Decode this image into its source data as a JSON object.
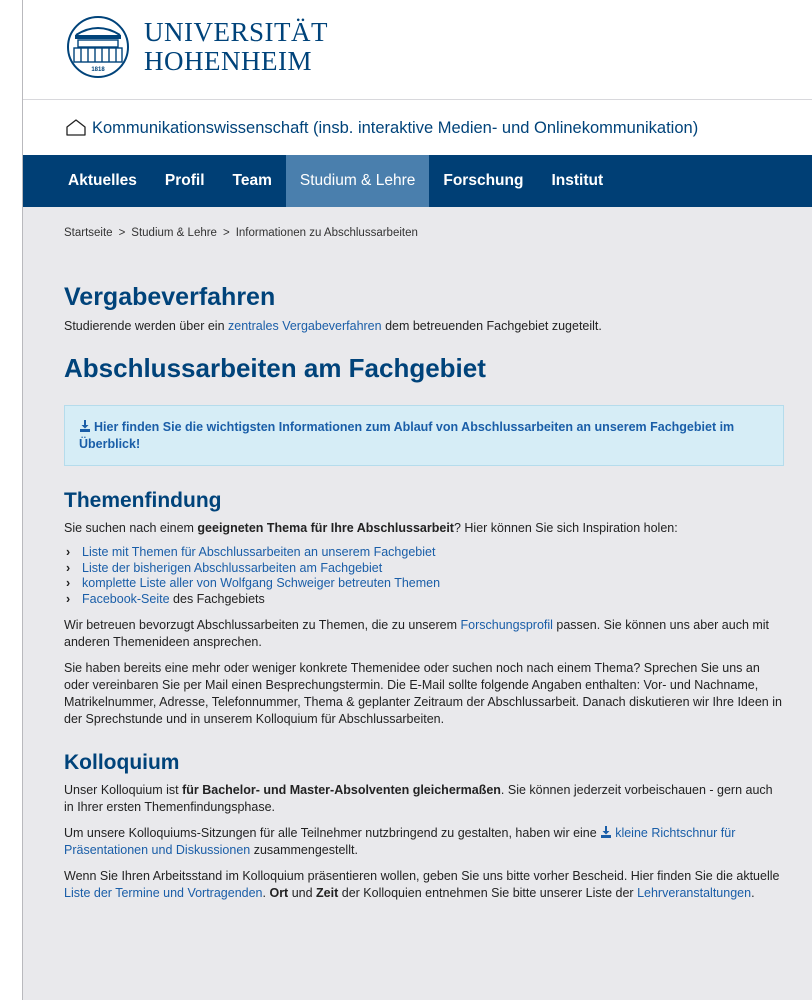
{
  "logo": {
    "line1": "UNIVERSITÄT",
    "line2": "HOHENHEIM",
    "year": "1818"
  },
  "subheader": {
    "label": "Kommunikationswissenschaft (insb. interaktive Medien- und Onlinekommunikation)"
  },
  "nav": {
    "items": [
      {
        "label": "Aktuelles"
      },
      {
        "label": "Profil"
      },
      {
        "label": "Team"
      },
      {
        "label": "Studium & Lehre"
      },
      {
        "label": "Forschung"
      },
      {
        "label": "Institut"
      }
    ],
    "active_index": 3
  },
  "breadcrumb": {
    "items": [
      "Startseite",
      "Studium & Lehre",
      "Informationen zu Abschlussarbeiten"
    ],
    "separator": ">"
  },
  "vergabe": {
    "title": "Vergabeverfahren",
    "text_before": "Studierende werden über ein ",
    "link": "zentrales Vergabeverfahren",
    "text_after": " dem betreuenden Fachgebiet zugeteilt."
  },
  "abschluss": {
    "title": "Abschlussarbeiten am Fachgebiet",
    "box_link": "Hier",
    "box_text": " finden Sie die wichtigsten Informationen zum Ablauf von Abschlussarbeiten an unserem Fachgebiet im Überblick!"
  },
  "themen": {
    "title": "Themenfindung",
    "intro_before": "Sie suchen nach einem ",
    "intro_bold": "geeigneten Thema für Ihre Abschlussarbeit",
    "intro_after": "? Hier können Sie sich Inspiration holen:",
    "links": [
      {
        "link": "Liste mit Themen für Abschlussarbeiten an unserem Fachgebiet",
        "after": ""
      },
      {
        "link": "Liste der bisherigen Abschlussarbeiten am Fachgebiet",
        "after": ""
      },
      {
        "link": "komplette Liste aller von Wolfgang Schweiger betreuten Themen",
        "after": ""
      },
      {
        "link": "Facebook-Seite",
        "after": " des Fachgebiets"
      }
    ],
    "p2_before": "Wir betreuen bevorzugt Abschlussarbeiten zu Themen, die zu unserem ",
    "p2_link": "Forschungsprofil",
    "p2_after": " passen. Sie können uns aber auch mit anderen Themenideen ansprechen.",
    "p3": "Sie haben bereits eine mehr oder weniger konkrete Themenidee oder suchen noch nach einem Thema? Sprechen Sie uns an oder vereinbaren Sie per Mail einen Besprechungstermin. Die E-Mail sollte folgende Angaben enthalten: Vor- und Nachname, Matrikelnummer, Adresse, Telefonnummer, Thema & geplanter Zeitraum der Abschlussarbeit. Danach diskutieren wir Ihre Ideen in der Sprechstunde und in unserem Kolloquium für Abschlussarbeiten."
  },
  "kolloquium": {
    "title": "Kolloquium",
    "p1_before": "Unser Kolloquium ist ",
    "p1_bold": "für Bachelor- und Master-Absolventen gleichermaßen",
    "p1_after": ". Sie können jederzeit vorbeischauen - gern auch in Ihrer ersten Themenfindungsphase.",
    "p2_before": "Um unsere Kolloquiums-Sitzungen für alle Teilnehmer nutzbringend zu gestalten, haben wir eine ",
    "p2_link": "kleine Richtschnur für Präsentationen und Diskussionen",
    "p2_after": " zusammengestellt.",
    "p3_before": "Wenn Sie Ihren Arbeitsstand im Kolloquium präsentieren wollen, geben Sie uns bitte vorher Bescheid. Hier finden Sie die aktuelle ",
    "p3_link": "Liste der Termine und Vortragenden",
    "p3_mid": ". ",
    "p3_bold1": "Ort",
    "p3_and": " und ",
    "p3_bold2": "Zeit",
    "p3_after": " der Kolloquien entnehmen Sie bitte unserer Liste der ",
    "p3_link2": "Lehrveranstaltungen",
    "p3_end": "."
  },
  "colors": {
    "brand_blue": "#00437a",
    "nav_bg": "#003f75",
    "nav_active": "#4a7fad",
    "link": "#1a5ea8",
    "info_bg": "#d6edf6"
  },
  "icons": [
    "university-building-icon",
    "home-icon",
    "download-icon",
    "chevron-right-icon"
  ]
}
